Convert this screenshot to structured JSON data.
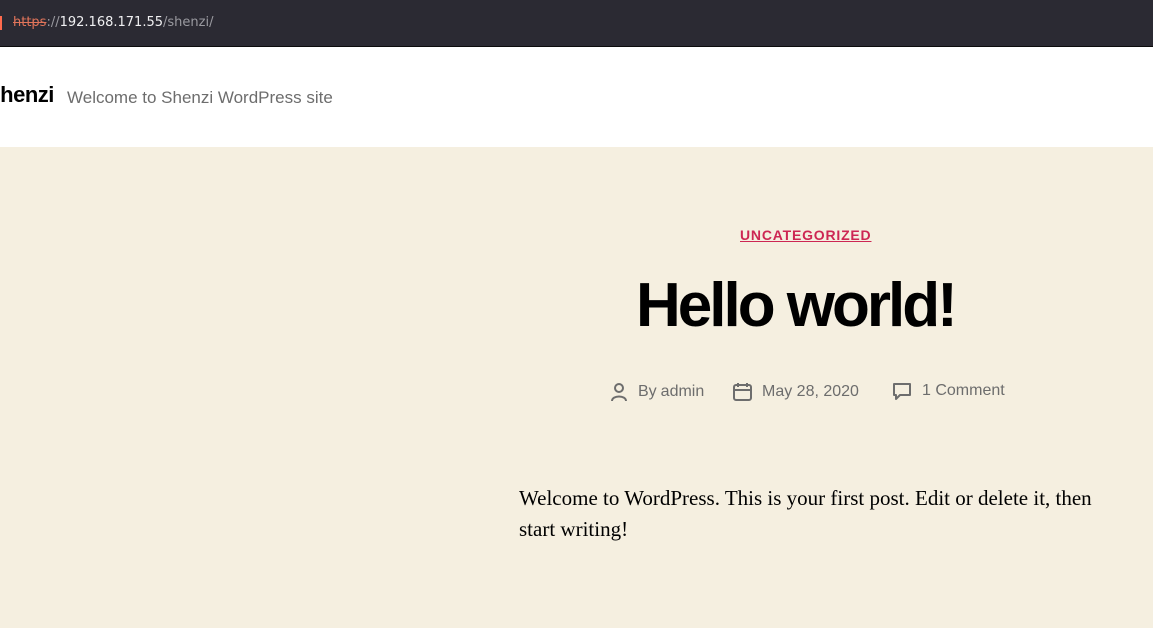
{
  "browser": {
    "url_scheme": "https",
    "url_separator": "://",
    "url_host": "192.168.171.55",
    "url_path": "/shenzi/"
  },
  "header": {
    "site_title": "Shenzi",
    "site_description": "Welcome to Shenzi WordPress site"
  },
  "post": {
    "category": "UNCATEGORIZED",
    "title": "Hello world!",
    "by_label": "By",
    "author": "admin",
    "date": "May 28, 2020",
    "comments": "1 Comment",
    "body": "Welcome to WordPress. This is your first post. Edit or delete it, then start writing!"
  },
  "colors": {
    "accent": "#cd2653",
    "background": "#f5efe0",
    "header_background": "#ffffff",
    "urlbar_background": "#2b2a33"
  },
  "icons": {
    "author": "person-icon",
    "date": "calendar-icon",
    "comments": "comment-bubble-icon"
  }
}
